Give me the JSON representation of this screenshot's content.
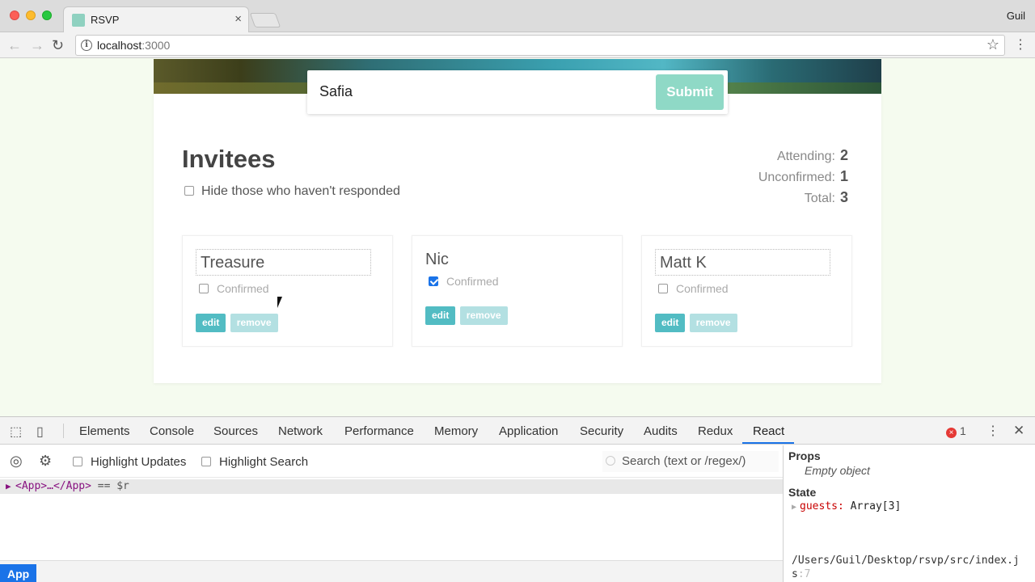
{
  "browser": {
    "tab_title": "RSVP",
    "tab_close": "×",
    "user": "Guil",
    "url_host": "localhost",
    "url_port": ":3000",
    "nav_back": "←",
    "nav_forward": "→",
    "nav_reload": "↻",
    "info_glyph": "i",
    "star_glyph": "☆",
    "menu_glyph": "⋮"
  },
  "form": {
    "input_value": "Safia",
    "submit_label": "Submit"
  },
  "invitees": {
    "title": "Invitees",
    "hide_label": "Hide those who haven't responded"
  },
  "stats": [
    {
      "label": "Attending:",
      "value": "2"
    },
    {
      "label": "Unconfirmed:",
      "value": "1"
    },
    {
      "label": "Total:",
      "value": "3"
    }
  ],
  "guests": [
    {
      "name": "Treasure",
      "confirmed_label": "Confirmed",
      "confirmed": false,
      "editing": true,
      "edit_label": "edit",
      "remove_label": "remove"
    },
    {
      "name": "Nic",
      "confirmed_label": "Confirmed",
      "confirmed": true,
      "editing": false,
      "edit_label": "edit",
      "remove_label": "remove"
    },
    {
      "name": "Matt K",
      "confirmed_label": "Confirmed",
      "confirmed": false,
      "editing": true,
      "edit_label": "edit",
      "remove_label": "remove"
    }
  ],
  "devtools": {
    "tabs": [
      "Elements",
      "Console",
      "Sources",
      "Network",
      "Performance",
      "Memory",
      "Application",
      "Security",
      "Audits",
      "Redux",
      "React"
    ],
    "active_tab": "React",
    "error_count": "1",
    "error_glyph": "×",
    "more_glyph": "⋮",
    "close_glyph": "✕",
    "inspect_glyph": "⬚",
    "device_glyph": "▯",
    "target_glyph": "◎",
    "gear_glyph": "⚙",
    "highlight_updates": "Highlight Updates",
    "highlight_search": "Highlight Search",
    "search_placeholder": "Search (text or /regex/)",
    "tree_arrow": "▶",
    "tree_node": "<App>…</App>",
    "tree_eq": " == $r",
    "bottom_badge": "App",
    "side": {
      "props_title": "Props",
      "props_empty": "Empty object",
      "state_title": "State",
      "state_tri": "▶",
      "guests_key": "guests:",
      "guests_val": " Array[3]",
      "source_path": "/Users/Guil/Desktop/rsvp/src/index.js",
      "source_line": ":7"
    }
  },
  "colors": {
    "accent": "#52bcc3",
    "submit": "#8fd9c6",
    "devtools_blue": "#1a73e8"
  }
}
